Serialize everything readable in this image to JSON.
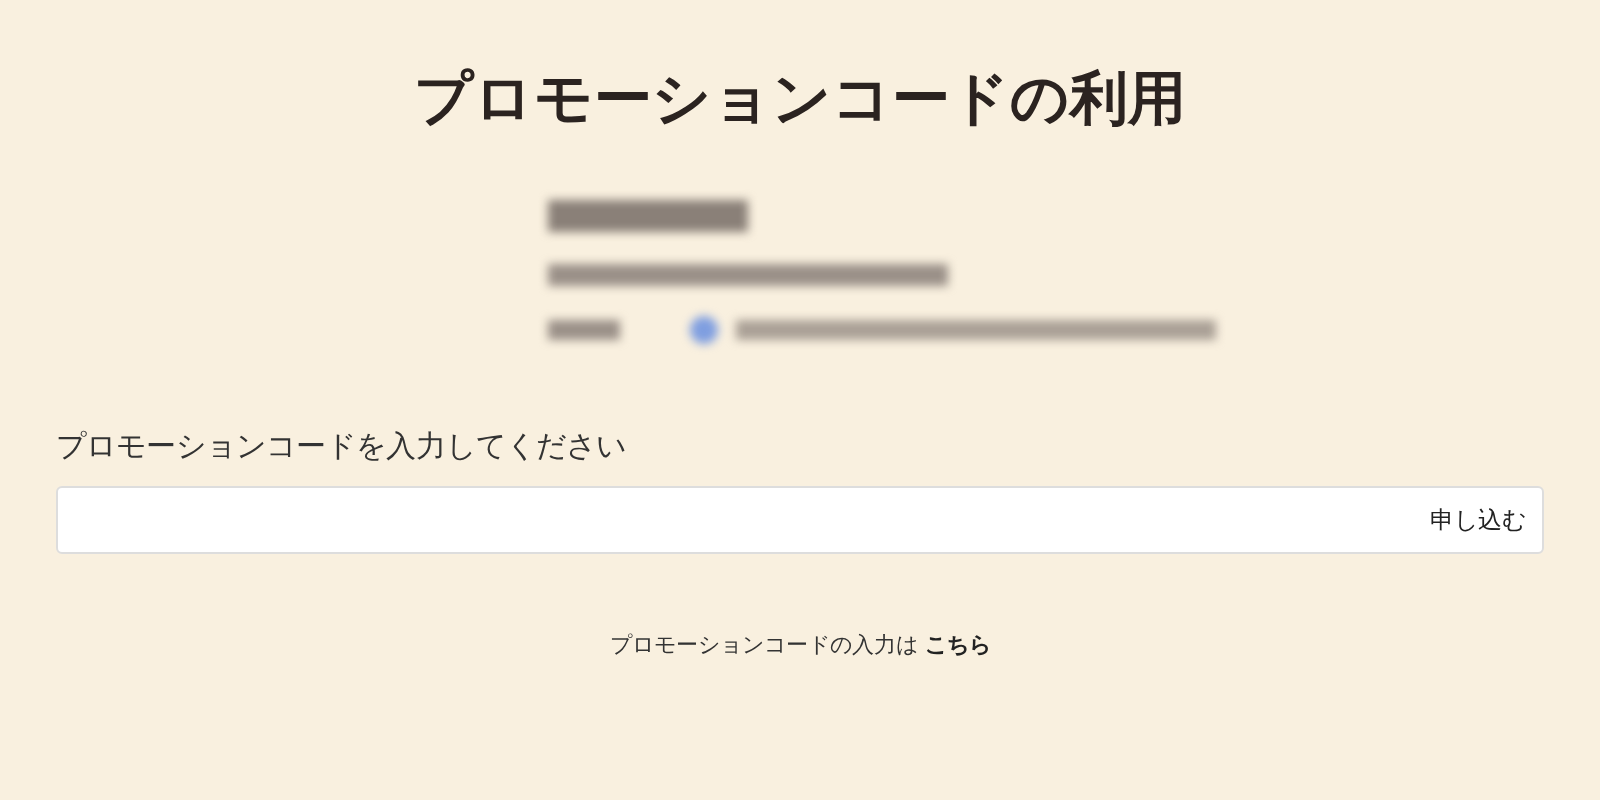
{
  "title": "プロモーションコードの利用",
  "form": {
    "label": "プロモーションコードを入力してください",
    "submit": "申し込む"
  },
  "footer": {
    "text": "プロモーションコードの入力は",
    "link": "こちら"
  }
}
